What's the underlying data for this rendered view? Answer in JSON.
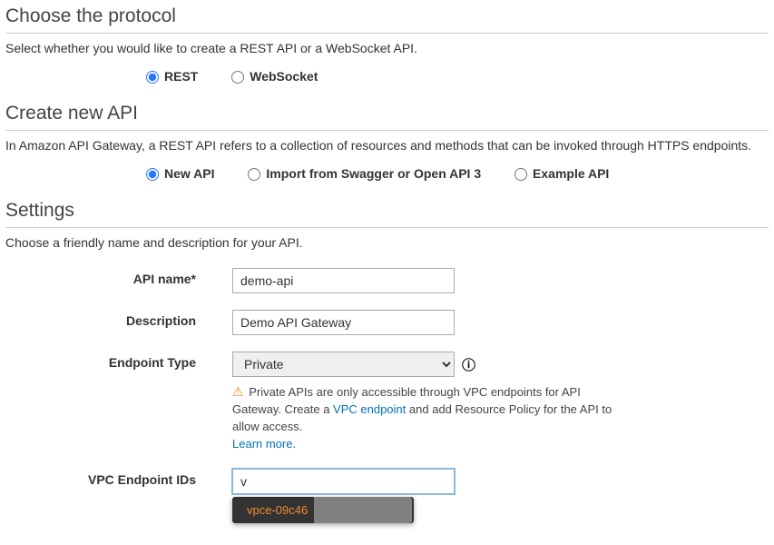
{
  "protocol": {
    "heading": "Choose the protocol",
    "subtitle": "Select whether you would like to create a REST API or a WebSocket API.",
    "options": {
      "rest": "REST",
      "websocket": "WebSocket"
    }
  },
  "create": {
    "heading": "Create new API",
    "subtitle": "In Amazon API Gateway, a REST API refers to a collection of resources and methods that can be invoked through HTTPS endpoints.",
    "options": {
      "new": "New API",
      "import": "Import from Swagger or Open API 3",
      "example": "Example API"
    }
  },
  "settings": {
    "heading": "Settings",
    "subtitle": "Choose a friendly name and description for your API.",
    "labels": {
      "api_name": "API name*",
      "description": "Description",
      "endpoint_type": "Endpoint Type",
      "vpc_endpoint_ids": "VPC Endpoint IDs"
    },
    "values": {
      "api_name": "demo-api",
      "description": "Demo API Gateway",
      "endpoint_type": "Private",
      "vpc_input": "v"
    },
    "warning": {
      "prefix": "Private APIs are only accessible through VPC endpoints for API Gateway. Create a ",
      "vpc_link": "VPC endpoint",
      "suffix": " and add Resource Policy for the API to allow access.",
      "learn_more": "Learn more."
    },
    "autocomplete_item": "vpce-09c46"
  }
}
